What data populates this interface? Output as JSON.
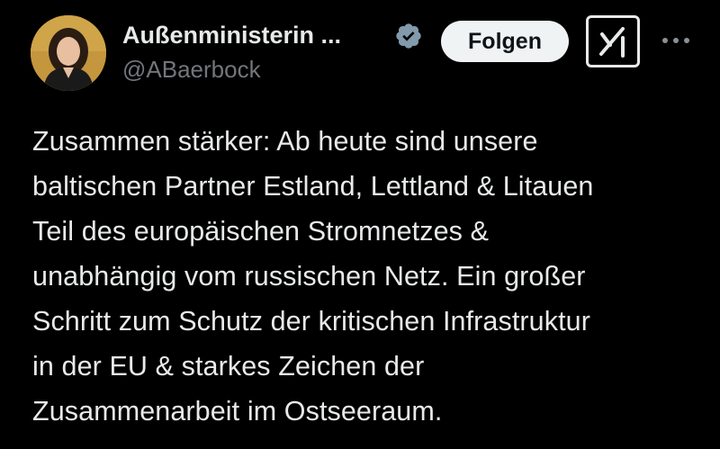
{
  "author": {
    "display_name": "Außenministerin ...",
    "handle": "@ABaerbock",
    "verified": true,
    "avatar_icon": "profile-photo"
  },
  "actions": {
    "follow_label": "Folgen",
    "grok_icon": "grok-icon",
    "more_icon": "more-dots-icon"
  },
  "tweet": {
    "text": "Zusammen stärker: Ab heute sind unsere\nbaltischen Partner Estland, Lettland & Litauen\nTeil des europäischen Stromnetzes &\nunabhängig vom russischen Netz. Ein großer\nSchritt zum Schutz der kritischen Infrastruktur\nin der EU & starkes Zeichen der\nZusammenarbeit im Ostseeraum."
  },
  "colors": {
    "background": "#000000",
    "text": "#e7e9ea",
    "secondary_text": "#71767b",
    "button_bg": "#eff3f4",
    "button_text": "#0f1419",
    "verified_badge": "#829aab"
  }
}
